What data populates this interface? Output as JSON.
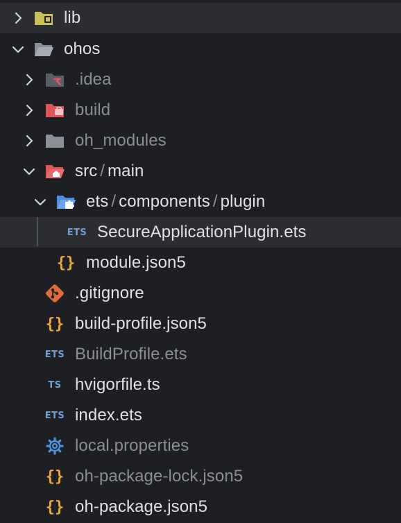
{
  "tree": {
    "items": [
      {
        "label": "lib"
      },
      {
        "label": "ohos"
      },
      {
        "label": ".idea"
      },
      {
        "label": "build"
      },
      {
        "label": "oh_modules"
      },
      {
        "seg1": "src",
        "seg2": "main",
        "separator": "/"
      },
      {
        "seg1": "ets",
        "seg2": "components",
        "seg3": "plugin",
        "separator": "/"
      },
      {
        "label": "SecureApplicationPlugin.ets",
        "badge": "ETS"
      },
      {
        "label": "module.json5",
        "badge": "{}"
      },
      {
        "label": ".gitignore"
      },
      {
        "label": "build-profile.json5",
        "badge": "{}"
      },
      {
        "label": "BuildProfile.ets",
        "badge": "ETS"
      },
      {
        "label": "hvigorfile.ts",
        "badge": "TS"
      },
      {
        "label": "index.ets",
        "badge": "ETS"
      },
      {
        "label": "local.properties"
      },
      {
        "label": "oh-package-lock.json5",
        "badge": "{}"
      },
      {
        "label": "oh-package.json5",
        "badge": "{}"
      }
    ]
  },
  "colors": {
    "background": "#1e1f22",
    "row_highlight": "#2b2d30",
    "text": "#dfe1e5",
    "text_dim": "#8b8e94",
    "json_icon": "#f0a732",
    "ets_badge": "#6ea0d4",
    "folder_gray": "#8a8f98",
    "folder_red": "#e0555a",
    "folder_blue": "#4d8fe0",
    "git_orange": "#e06b3a"
  }
}
